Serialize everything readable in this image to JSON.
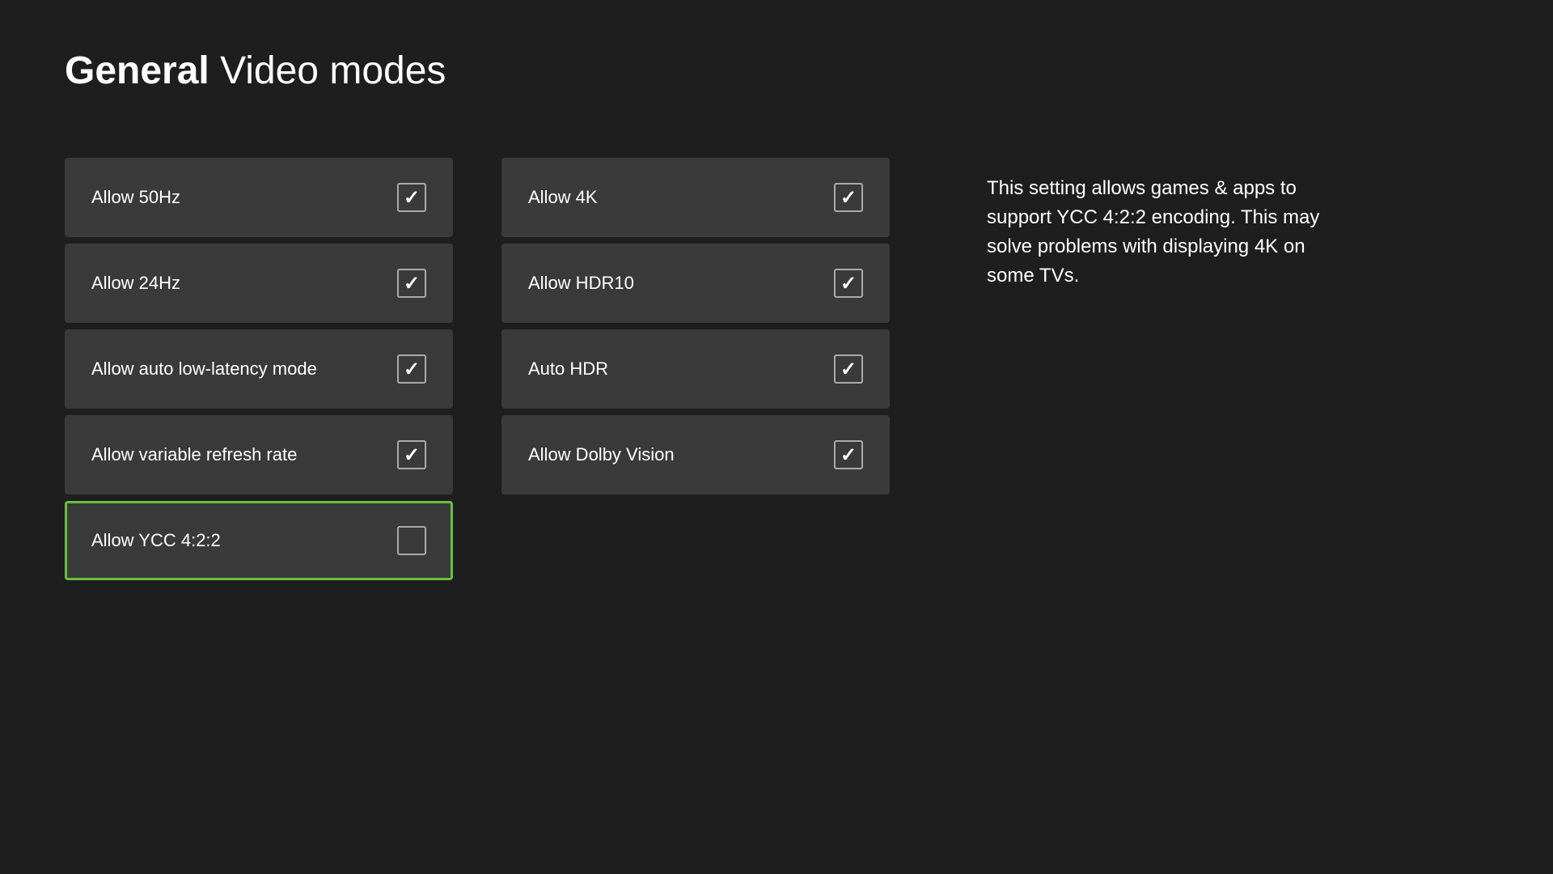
{
  "header": {
    "title_strong": "General",
    "title_light": " Video modes"
  },
  "left_column": [
    {
      "id": "allow-50hz",
      "label": "Allow 50Hz",
      "checked": true,
      "selected": false
    },
    {
      "id": "allow-24hz",
      "label": "Allow 24Hz",
      "checked": true,
      "selected": false
    },
    {
      "id": "allow-auto-low-latency",
      "label": "Allow auto low-latency mode",
      "checked": true,
      "selected": false
    },
    {
      "id": "allow-variable-refresh-rate",
      "label": "Allow variable refresh rate",
      "checked": true,
      "selected": false
    },
    {
      "id": "allow-ycc-422",
      "label": "Allow YCC 4:2:2",
      "checked": false,
      "selected": true
    }
  ],
  "right_column": [
    {
      "id": "allow-4k",
      "label": "Allow 4K",
      "checked": true,
      "selected": false
    },
    {
      "id": "allow-hdr10",
      "label": "Allow HDR10",
      "checked": true,
      "selected": false
    },
    {
      "id": "auto-hdr",
      "label": "Auto HDR",
      "checked": true,
      "selected": false
    },
    {
      "id": "allow-dolby-vision",
      "label": "Allow Dolby Vision",
      "checked": true,
      "selected": false
    }
  ],
  "info_panel": {
    "text": "This setting allows games & apps to support YCC 4:2:2 encoding. This may solve problems with displaying 4K on some TVs."
  }
}
